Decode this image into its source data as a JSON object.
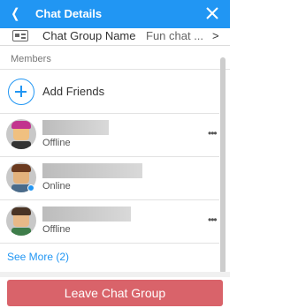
{
  "header": {
    "title": "Chat Details",
    "back_icon": "chevron-left-icon",
    "close_icon": "close-icon",
    "accent": "#2196f3"
  },
  "group": {
    "label": "Chat Group Name",
    "value": "Fun chat ...",
    "chevron": ">"
  },
  "members_label": "Members",
  "add_friends": {
    "label": "Add Friends"
  },
  "members": [
    {
      "status": "Offline",
      "online": false
    },
    {
      "status": "Online",
      "online": true
    },
    {
      "status": "Offline",
      "online": false
    }
  ],
  "see_more": "See More (2)",
  "leave_button": {
    "label": "Leave Chat Group",
    "color": "#d9636a"
  }
}
